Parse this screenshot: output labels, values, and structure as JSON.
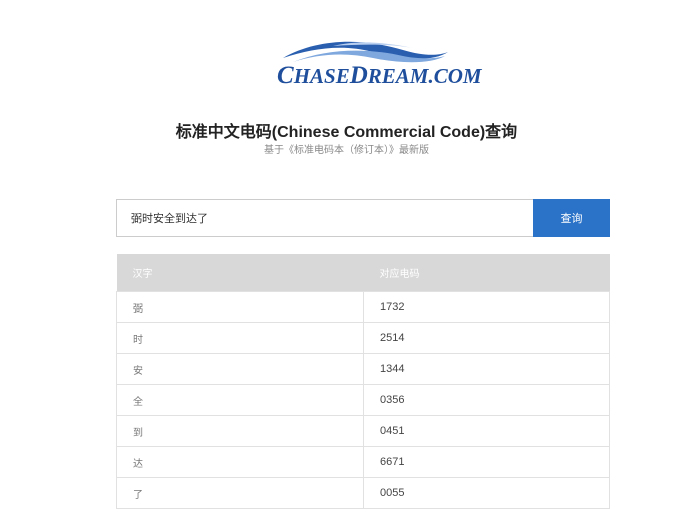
{
  "logo": {
    "text_big_c": "C",
    "text_hase": "HASE",
    "text_big_d": "D",
    "text_ream": "REAM",
    "text_com": ".COM",
    "icon": "wave-logo",
    "color": "#1f4f9c"
  },
  "header": {
    "title": "标准中文电码(Chinese Commercial Code)查询",
    "subtitle": "基于《标准电码本（修订本）》最新版"
  },
  "search": {
    "value": "弼时安全到达了",
    "button_label": "查询",
    "button_color": "#2b73c8"
  },
  "table": {
    "headers": [
      "汉字",
      "对应电码"
    ],
    "rows": [
      {
        "char": "弼",
        "code": "1732"
      },
      {
        "char": "时",
        "code": "2514"
      },
      {
        "char": "安",
        "code": "1344"
      },
      {
        "char": "全",
        "code": "0356"
      },
      {
        "char": "到",
        "code": "0451"
      },
      {
        "char": "达",
        "code": "6671"
      },
      {
        "char": "了",
        "code": "0055"
      }
    ]
  }
}
